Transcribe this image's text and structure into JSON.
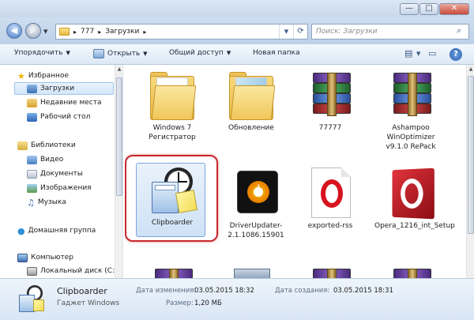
{
  "window": {
    "controls": [
      "—",
      "□",
      "✕"
    ]
  },
  "address_bar": {
    "segments": [
      "777",
      "Загрузки"
    ],
    "search_placeholder": "Поиск: Загрузки"
  },
  "command_bar": {
    "organize": "Упорядочить",
    "open": "Открыть",
    "share": "Общий доступ",
    "new_folder": "Новая папка",
    "help": "?"
  },
  "nav_pane": {
    "favorites": "Избранное",
    "downloads": "Загрузки",
    "recent": "Недавние места",
    "desktop": "Рабочий стол",
    "libraries": "Библиотеки",
    "video": "Видео",
    "documents": "Документы",
    "images": "Изображения",
    "music": "Музыка",
    "homegroup": "Домашняя группа",
    "computer": "Компьютер",
    "local_disk": "Локальный диск (C:)"
  },
  "files": [
    {
      "name": "Windows 7 Регистратор",
      "icon": "folder-icon"
    },
    {
      "name": "Обновление",
      "icon": "folder-icon"
    },
    {
      "name": "77777",
      "icon": "winrar-archive-icon"
    },
    {
      "name": "Ashampoo WinOptimizer v9.1.0 RePack",
      "icon": "winrar-archive-icon"
    },
    {
      "name": "Clipboarder",
      "icon": "clipboarder-gadget-icon"
    },
    {
      "name": "DriverUpdater-2.1.1086.15901",
      "icon": "driverupdater-icon"
    },
    {
      "name": "exported-rss",
      "icon": "opera-document-icon"
    },
    {
      "name": "Opera_1216_int_Setup",
      "icon": "opera-installer-icon"
    }
  ],
  "details": {
    "name": "Clipboarder",
    "type": "Гаджет Windows",
    "modified_label": "Дата изменения:",
    "modified_value": "03.05.2015 18:32",
    "created_label": "Дата создания:",
    "created_value": "03.05.2015 18:31",
    "size_label": "Размер:",
    "size_value": "1,20 МБ"
  },
  "colors": {
    "selection_highlight": "#c8282c",
    "accent": "#3a5a86"
  }
}
